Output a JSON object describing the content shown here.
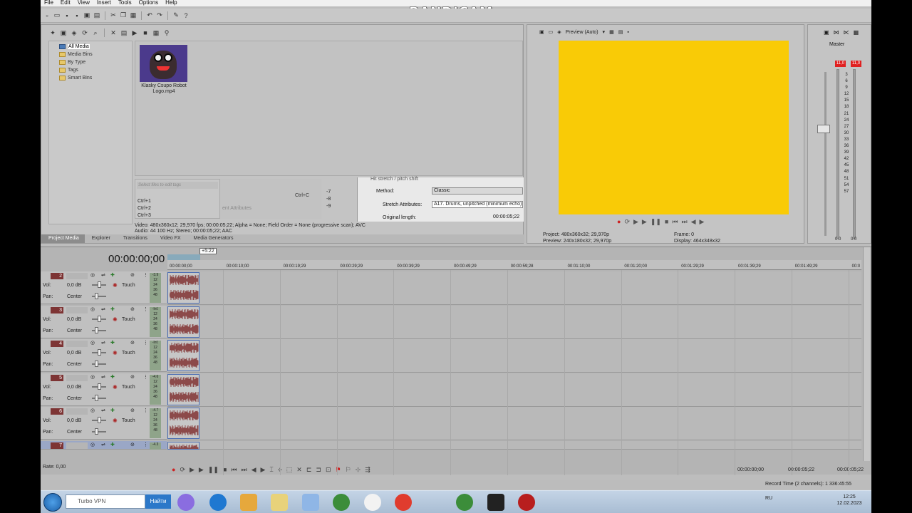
{
  "menu": [
    "File",
    "Edit",
    "View",
    "Insert",
    "Tools",
    "Options",
    "Help"
  ],
  "watermark": "www.BANDICAM.com",
  "media_tree": [
    {
      "label": "All Media",
      "selected": true
    },
    {
      "label": "Media Bins"
    },
    {
      "label": "By Type"
    },
    {
      "label": "Tags"
    },
    {
      "label": "Smart Bins"
    }
  ],
  "media_item": {
    "name": "Klasky Csupo Robot Logo.mp4"
  },
  "search_placeholder": "Select files to edit tags",
  "shortcuts": [
    "Ctrl+1",
    "Ctrl+2",
    "Ctrl+3"
  ],
  "ctrl_c": "Ctrl+C",
  "ghost_text": "ent Attributes",
  "numbers": [
    "-7",
    "-8",
    "-9"
  ],
  "fx": {
    "header": "Hit stretch / pitch shift",
    "method_label": "Method:",
    "method_value": "Classic",
    "stretch_label": "Stretch Attributes:",
    "stretch_value": "A17. Drums, unpitched (minimum echo)",
    "length_label": "Original length:",
    "length_value": "00:00:05;22"
  },
  "file_info": [
    "Video: 480x360x12; 29,970 fps; 00:00:05;22; Alpha = None; Field Order = None (progressive scan); AVC",
    "Audio: 44 100 Hz; Stereo; 00:00:05;22; AAC"
  ],
  "panel_tabs": [
    "Project Media",
    "Explorer",
    "Transitions",
    "Video FX",
    "Media Generators"
  ],
  "preview": {
    "mode": "Preview (Auto)",
    "frame_color": "#f9cb06",
    "project_label": "Project:",
    "project_value": "480x360x32; 29,970p",
    "preview_label": "Preview:",
    "preview_value": "240x180x32; 29,970p",
    "frame_label": "Frame:",
    "frame_value": "0",
    "display_label": "Display:",
    "display_value": "464x348x32"
  },
  "master": {
    "title": "Master",
    "peak_left": "11,0",
    "peak_right": "11,0",
    "scale": [
      "3",
      "6",
      "9",
      "12",
      "15",
      "18",
      "21",
      "24",
      "27",
      "30",
      "33",
      "36",
      "39",
      "42",
      "45",
      "48",
      "51",
      "54",
      "57"
    ],
    "bottom_left": "0.0",
    "bottom_right": "0.0"
  },
  "timeline": {
    "timecode": "00:00:00;00",
    "loop_count": "+5:22",
    "ruler": [
      "00:00:00;00",
      "00:00:10;00",
      "00:00:19;29",
      "00:00:29;29",
      "00:00:39;29",
      "00:00:49;29",
      "00:00:59;28",
      "00:01:10;00",
      "00:01:20;00",
      "00:01:29;29",
      "00:01:39;29",
      "00:01:49;29",
      "00:0"
    ],
    "tracks": [
      {
        "num": "2",
        "vol": "0,0 dB",
        "pan": "Center",
        "mode": "Touch",
        "level": "-3.9"
      },
      {
        "num": "3",
        "vol": "0,0 dB",
        "pan": "Center",
        "mode": "Touch",
        "level": "-Inf."
      },
      {
        "num": "4",
        "vol": "0,0 dB",
        "pan": "Center",
        "mode": "Touch",
        "level": "-Inf."
      },
      {
        "num": "5",
        "vol": "0,0 dB",
        "pan": "Center",
        "mode": "Touch",
        "level": "-4.6"
      },
      {
        "num": "6",
        "vol": "0,0 dB",
        "pan": "Center",
        "mode": "Touch",
        "level": "-4.7"
      },
      {
        "num": "7",
        "vol": "",
        "pan": "",
        "mode": "",
        "level": "-4.3"
      }
    ],
    "vol_label": "Vol:",
    "pan_label": "Pan:",
    "meter_scale": [
      "12",
      "24",
      "36",
      "48"
    ],
    "rate": "Rate: 0,00",
    "time_start": "00:00:00;00",
    "time_end": "00:00:05;22",
    "time_length": "00:00:05;22"
  },
  "status": "Record Time (2 channels): 1 336:45:55",
  "taskbar": {
    "search_value": "Turbo VPN",
    "search_button": "Найти",
    "lang": "RU",
    "time": "12:25",
    "date": "12.02.2023"
  }
}
